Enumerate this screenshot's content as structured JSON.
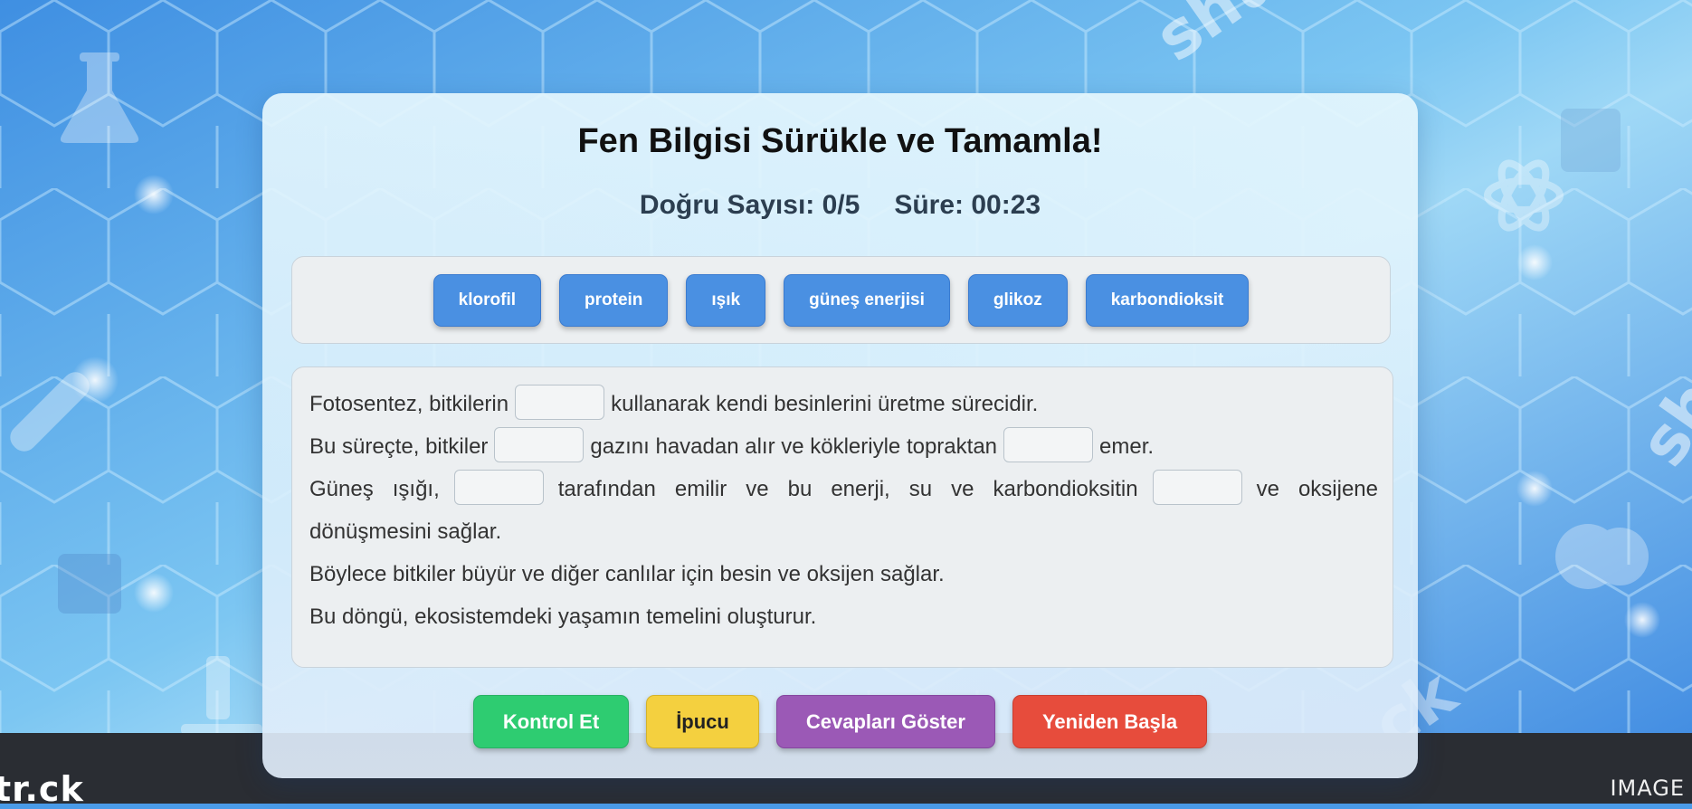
{
  "game": {
    "title": "Fen Bilgisi Sürükle ve Tamamla!",
    "score_text": "Doğru Sayısı: 0/5",
    "timer_text": "Süre: 00:23"
  },
  "word_bank": [
    "klorofil",
    "protein",
    "ışık",
    "güneş enerjisi",
    "glikoz",
    "karbondioksit"
  ],
  "passage": {
    "line1": {
      "before": "Fotosentez, bitkilerin",
      "after": "kullanarak kendi besinlerini üretme sürecidir."
    },
    "line2": {
      "before": "Bu süreçte, bitkiler",
      "middle": "gazını havadan alır ve kökleriyle topraktan",
      "after": "emer."
    },
    "line3": {
      "before": "Güneş ışığı,",
      "middle": "tarafından emilir ve bu enerji, su ve karbondioksitin",
      "after": "ve oksijene dönüşmesini sağlar."
    },
    "line4": "Böylece bitkiler büyür ve diğer canlılar için besin ve oksijen sağlar.",
    "line5": "Bu döngü, ekosistemdeki yaşamın temelini oluşturur."
  },
  "buttons": {
    "check": "Kontrol Et",
    "hint": "İpucu",
    "show_answers": "Cevapları Göster",
    "restart": "Yeniden Başla"
  },
  "colors": {
    "word_chip": "#4a90e2",
    "check": "#2ecc71",
    "hint": "#f4d03f",
    "show_answers": "#9b59b6",
    "restart": "#e74c3c"
  },
  "stock_watermark": {
    "logo_text": "tr.ck",
    "right_label": "IMAGE",
    "overlay_texts": [
      "shu",
      "sh",
      "ck"
    ]
  },
  "background_icons": [
    "flask-icon",
    "atom-icon",
    "test-tube-icon",
    "brain-icon",
    "microscope-icon",
    "dna-icon"
  ]
}
